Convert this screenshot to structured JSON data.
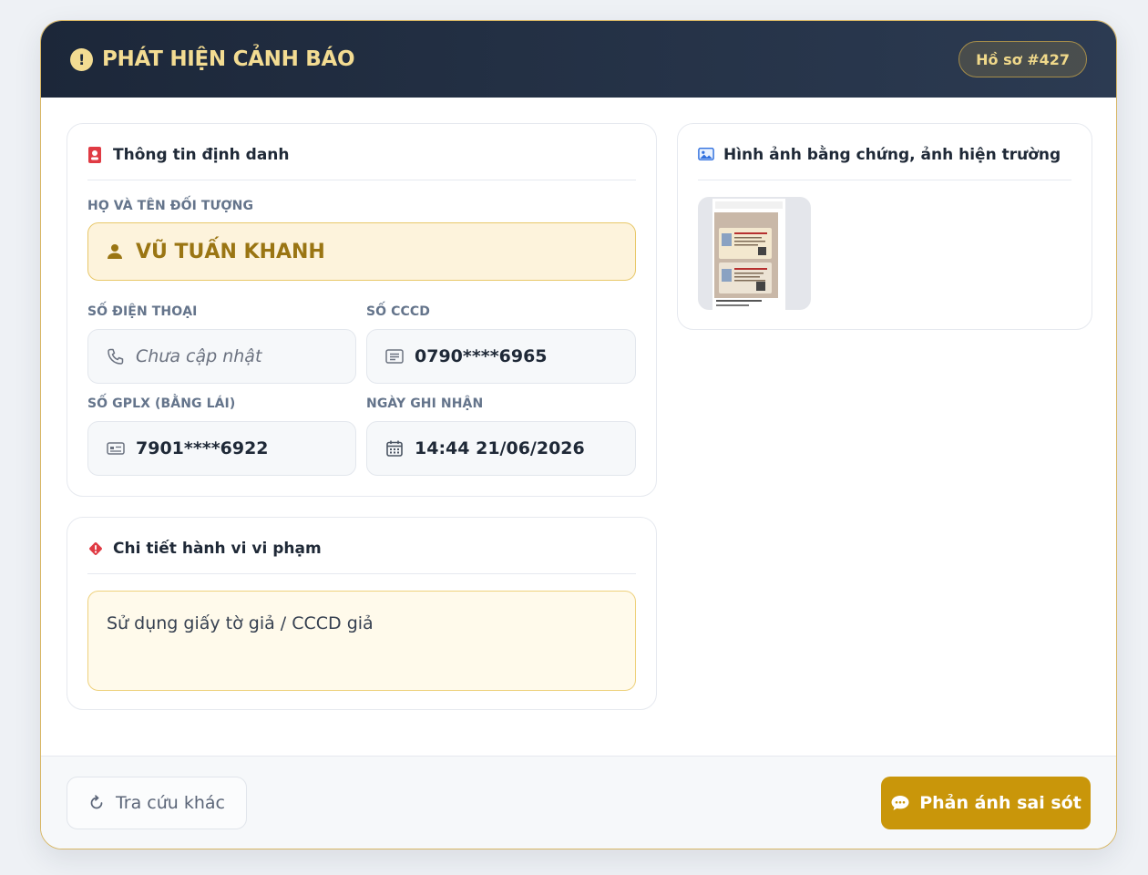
{
  "header": {
    "title": "PHÁT HIỆN CẢNH BÁO",
    "file_badge": "Hồ sơ #427"
  },
  "identity": {
    "title": "Thông tin định danh",
    "name_label": "HỌ VÀ TÊN ĐỐI TƯỢNG",
    "name_value": "VŨ TUẤN KHANH",
    "phone_label": "SỐ ĐIỆN THOẠI",
    "phone_value": "Chưa cập nhật",
    "cccd_label": "SỐ CCCD",
    "cccd_value": "0790****6965",
    "license_label": "SỐ GPLX (BẰNG LÁI)",
    "license_value": "7901****6922",
    "date_label": "NGÀY GHI NHẬN",
    "date_value": "14:44 21/06/2026"
  },
  "violation": {
    "title": "Chi tiết hành vi vi phạm",
    "text": "Sử dụng giấy tờ giả / CCCD giả"
  },
  "evidence": {
    "title": "Hình ảnh bằng chứng, ảnh hiện trường"
  },
  "footer": {
    "search_again": "Tra cứu khác",
    "report_error": "Phản ánh sai sót"
  },
  "colors": {
    "header_bg": "#1c2739",
    "accent_gold": "#c9960a",
    "title_gold": "#f3dc92",
    "alert_red": "#e03b44"
  }
}
